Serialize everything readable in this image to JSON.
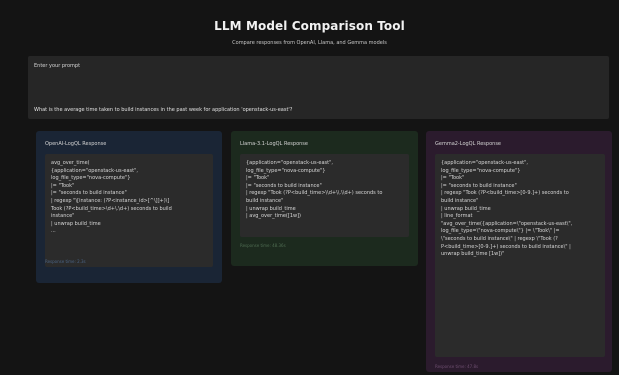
{
  "header": {
    "title": "LLM Model Comparison Tool",
    "subtitle": "Compare responses from OpenAI, Llama, and Gemma models"
  },
  "prompt": {
    "label": "Enter your prompt",
    "value": "What is the average time taken to build instances in the past week for application 'openstack-us-east'?"
  },
  "panels": {
    "openai": {
      "title": "OpenAI-LogQL Response",
      "lines": [
        "avg_over_time(",
        "  {application=\"openstack-us-east\",",
        "log_file_type=\"nova-compute\"}",
        "    |= \"Took\"",
        "    |= \"seconds to build instance\"",
        "    | regexp \"\\[instance: (?P<instance_id>[^\\]]+)\\]",
        "Took (?P<build_time>\\d+\\.\\d+) seconds to build",
        "instance\"",
        "    | unwrap build_time",
        "    ..."
      ],
      "response_time": "Response time: 2.3s",
      "accent_color": "#1a2535"
    },
    "llama": {
      "title": "Llama-3.1-LogQL Response",
      "lines": [
        "{application=\"openstack-us-east\",",
        "log_file_type=\"nova-compute\"}",
        "|= \"Took\"",
        "|= \"seconds to build instance\"",
        "| regexp \"Took (?P<build_time>\\\\d+\\\\.\\\\d+) seconds to",
        "build instance\"",
        "| unwrap build_time",
        "| avg_over_time([1w])"
      ],
      "response_time": "Response time: 48.36s",
      "accent_color": "#1c2a1e"
    },
    "gemma": {
      "title": "Gemma2-LogQL Response",
      "lines": [
        "{application=\"openstack-us-east\",",
        "log_file_type=\"nova-compute\"}",
        "|= \"Took\"",
        "|= \"seconds to build instance\"",
        "| regexp \"Took (?P<build_time>[0-9.]+) seconds to",
        "build instance\"",
        "| unwrap build_time",
        "| line_format",
        "\"avg_over_time({application=\\\"openstack-us-east\\\",",
        "log_file_type=\\\"nova-compute\\\"} |= \\\"Took\\\" |=",
        "\\\"seconds to build instance\\\" | regexp \\\"Took (?",
        "P<build_time>[0-9.]+) seconds to build instance\\\" |",
        "unwrap build_time [1w])\""
      ],
      "response_time": "Response time: 47.8s",
      "accent_color": "#2b1b2d"
    }
  }
}
